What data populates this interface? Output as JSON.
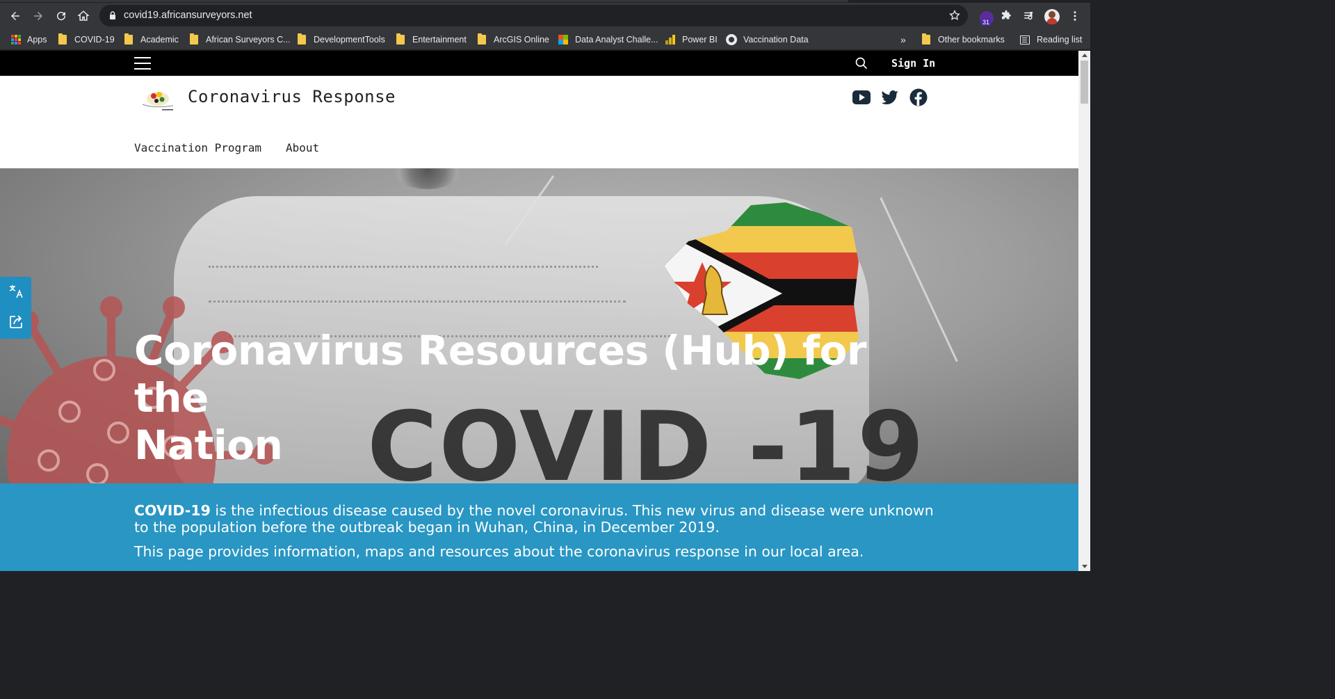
{
  "browser": {
    "url": "covid19.africansurveyors.net",
    "extension_badge": "31",
    "bookmarks": [
      {
        "label": "Apps",
        "icon": "apps-grid-icon"
      },
      {
        "label": "COVID-19",
        "icon": "folder-icon"
      },
      {
        "label": "Academic",
        "icon": "folder-icon"
      },
      {
        "label": "African Surveyors C...",
        "icon": "folder-icon"
      },
      {
        "label": "DevelopmentTools",
        "icon": "folder-icon"
      },
      {
        "label": "Entertainment",
        "icon": "folder-icon"
      },
      {
        "label": "ArcGIS Online",
        "icon": "folder-icon"
      },
      {
        "label": "Data Analyst Challe...",
        "icon": "microsoft-icon"
      },
      {
        "label": "Power BI",
        "icon": "powerbi-icon"
      },
      {
        "label": "Vaccination Data",
        "icon": "github-icon"
      }
    ],
    "overflow_label": "»",
    "other_bookmarks": "Other bookmarks",
    "reading_list": "Reading list"
  },
  "site": {
    "topbar": {
      "signin_label": "Sign In"
    },
    "header": {
      "title": "Coronavirus Response",
      "nav": [
        "Vaccination Program",
        "About"
      ],
      "social": [
        "youtube-icon",
        "twitter-icon",
        "facebook-icon"
      ]
    },
    "hero": {
      "title_line1": "Coronavirus Resources (Hub) for the",
      "title_line2": "Nation",
      "watermark": "COVID -19"
    },
    "intro": {
      "lead_bold": "COVID-19",
      "lead_rest": " is the infectious disease caused by the novel coronavirus. This new virus and disease were unknown to the population before the outbreak began in Wuhan, China, in December 2019.",
      "second": "This page provides information, maps and resources about the coronavirus response in our local area."
    }
  },
  "colors": {
    "chrome_bg": "#35363a",
    "omnibox_bg": "#202124",
    "site_topbar": "#000000",
    "band_blue": "#2996c3",
    "side_tab_blue": "#1f8ec0",
    "social_icon": "#1a2b3c"
  }
}
